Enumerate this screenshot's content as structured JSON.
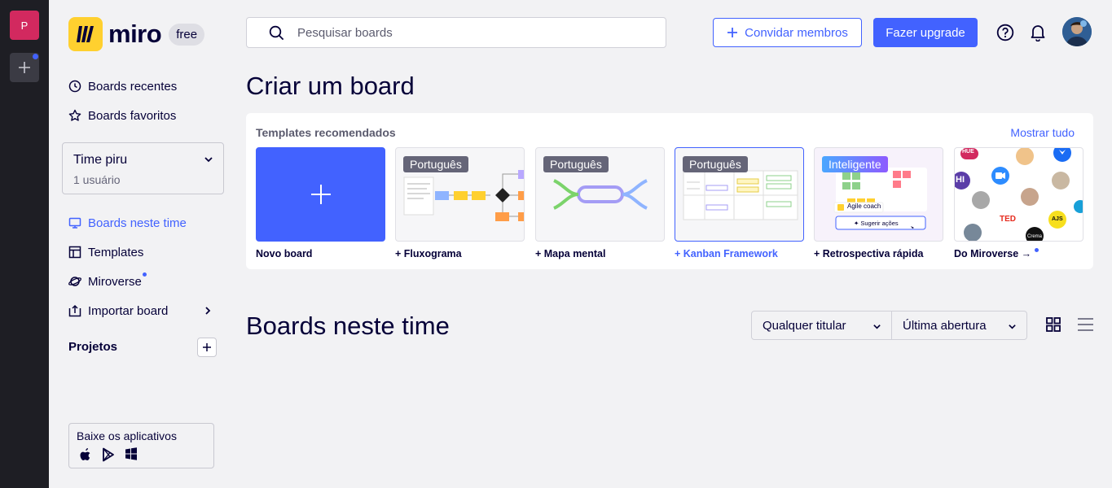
{
  "workspace": {
    "initial": "P",
    "add_icon": "plus-icon",
    "notification_color": "#4262ff"
  },
  "brand": {
    "name": "miro",
    "plan": "free",
    "logo_color": "#ffd02f"
  },
  "sidebar": {
    "recent": "Boards recentes",
    "favorites": "Boards favoritos",
    "team": {
      "name": "Time piru",
      "members": "1 usuário"
    },
    "items": [
      {
        "label": "Boards neste time",
        "icon": "board-icon",
        "active": true
      },
      {
        "label": "Templates",
        "icon": "template-icon"
      },
      {
        "label": "Miroverse",
        "icon": "planet-icon",
        "new": true
      },
      {
        "label": "Importar board",
        "icon": "import-icon",
        "chevron": true
      }
    ],
    "projects_label": "Projetos",
    "apps": {
      "title": "Baixe os aplicativos",
      "platforms": [
        "apple-icon",
        "google-play-icon",
        "windows-icon"
      ]
    }
  },
  "topbar": {
    "search_placeholder": "Pesquisar boards",
    "invite_label": "Convidar membros",
    "upgrade_label": "Fazer upgrade",
    "help_icon": "help-icon",
    "bell_icon": "bell-icon"
  },
  "create": {
    "title": "Criar um board",
    "recommended_label": "Templates recomendados",
    "show_all": "Mostrar tudo",
    "templates": [
      {
        "label": "Novo board"
      },
      {
        "label": "+ Fluxograma",
        "tag": "Português"
      },
      {
        "label": "+ Mapa mental",
        "tag": "Português"
      },
      {
        "label": "+ Kanban Framework",
        "tag": "Português"
      },
      {
        "label": "+ Retrospectiva rápida",
        "tag": "Inteligente",
        "inner": {
          "coach": "Agile coach",
          "action": "Sugerir ações"
        }
      },
      {
        "label": "Do Miroverse →",
        "brands": {
          "hue": "HUE",
          "ted": "TED",
          "js": "AJS",
          "crema": "Crema",
          "hi": "HI"
        }
      }
    ]
  },
  "boards": {
    "title": "Boards neste time",
    "owner_filter": "Qualquer titular",
    "sort_filter": "Última abertura",
    "accent": "#4262ff"
  }
}
